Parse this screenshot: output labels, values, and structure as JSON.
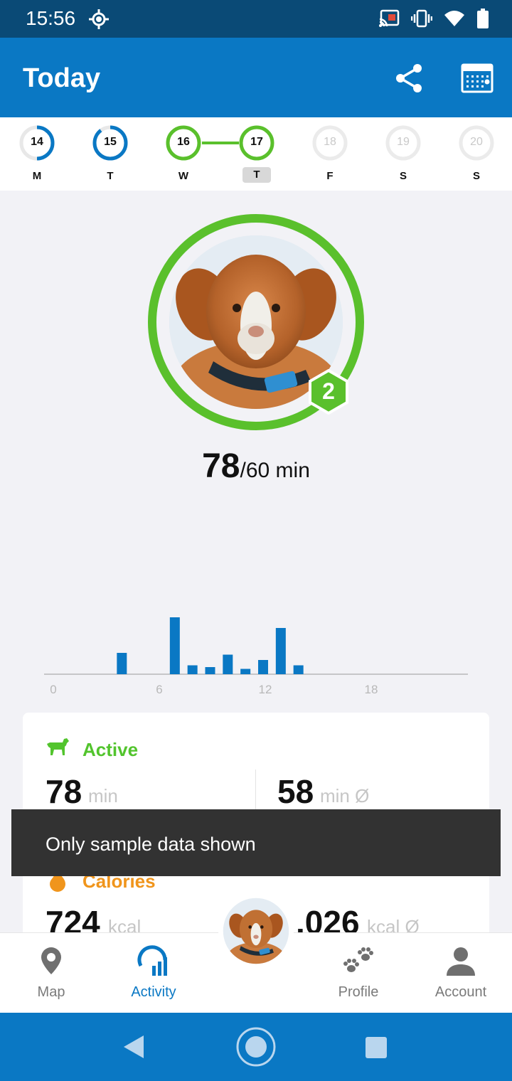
{
  "status_bar": {
    "time": "15:56",
    "icons": [
      "location-icon",
      "cast-icon",
      "vibrate-icon",
      "wifi-icon",
      "battery-icon"
    ]
  },
  "app_bar": {
    "title": "Today",
    "actions": [
      "share-icon",
      "calendar-icon"
    ]
  },
  "week": {
    "days": [
      {
        "num": "14",
        "dow": "M",
        "progress": 0.5,
        "state": "partial"
      },
      {
        "num": "15",
        "dow": "T",
        "progress": 0.9,
        "state": "partial"
      },
      {
        "num": "16",
        "dow": "W",
        "progress": 1.0,
        "state": "complete"
      },
      {
        "num": "17",
        "dow": "T",
        "progress": 1.0,
        "state": "complete-selected"
      },
      {
        "num": "18",
        "dow": "F",
        "progress": 0,
        "state": "future"
      },
      {
        "num": "19",
        "dow": "S",
        "progress": 0,
        "state": "future"
      },
      {
        "num": "20",
        "dow": "S",
        "progress": 0,
        "state": "future"
      }
    ]
  },
  "goal": {
    "value": "78",
    "target": "/60 min",
    "streak_badge": "2",
    "progress": 1.3
  },
  "chart_data": {
    "type": "bar",
    "x_ticks": [
      "0",
      "6",
      "12",
      "18"
    ],
    "xlim": [
      0,
      24
    ],
    "hours": [
      4,
      7,
      8,
      9,
      10,
      11,
      12,
      13,
      14
    ],
    "values": [
      12,
      32,
      5,
      4,
      11,
      3,
      8,
      26,
      5
    ]
  },
  "stats": {
    "active_label": "Active",
    "active_value": "78",
    "active_unit": "min",
    "active_avg_value": "58",
    "active_avg_unit": "min Ø",
    "calories_label": "Calories",
    "calories_value": "724",
    "calories_unit": "kcal",
    "calories_avg_value": ".026",
    "calories_avg_unit": "kcal Ø"
  },
  "snackbar": {
    "text": "Only sample data shown"
  },
  "bottom_nav": {
    "items": [
      {
        "label": "Map",
        "icon": "map-pin-icon"
      },
      {
        "label": "Activity",
        "icon": "activity-icon"
      },
      {
        "label": "Profile",
        "icon": "paws-icon"
      },
      {
        "label": "Account",
        "icon": "person-icon"
      }
    ],
    "active": "Activity"
  },
  "colors": {
    "primary": "#0a78c4",
    "status_bar": "#0a4a76",
    "goal_green": "#5ac02c",
    "calories_orange": "#f0951c"
  }
}
